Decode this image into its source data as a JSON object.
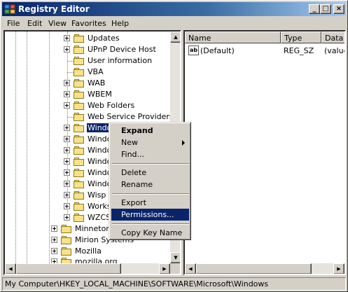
{
  "window": {
    "title": "Registry Editor",
    "controls": {
      "minimize": "_",
      "maximize": "□",
      "close": "×"
    }
  },
  "menu": [
    "File",
    "Edit",
    "View",
    "Favorites",
    "Help"
  ],
  "tree": {
    "microsoft_children": [
      {
        "label": "Updates",
        "expandable": true
      },
      {
        "label": "UPnP Device Host",
        "expandable": true
      },
      {
        "label": "User information",
        "expandable": false
      },
      {
        "label": "VBA",
        "expandable": false
      },
      {
        "label": "WAB",
        "expandable": true
      },
      {
        "label": "WBEM",
        "expandable": true
      },
      {
        "label": "Web Folders",
        "expandable": true
      },
      {
        "label": "Web Service Providers",
        "expandable": false
      },
      {
        "label": "Windows",
        "expandable": true,
        "selected": true
      },
      {
        "label": "Windo",
        "expandable": true
      },
      {
        "label": "Windo",
        "expandable": true
      },
      {
        "label": "Windo",
        "expandable": true
      },
      {
        "label": "Windo",
        "expandable": true
      },
      {
        "label": "Windo",
        "expandable": true
      },
      {
        "label": "Wisp",
        "expandable": true
      },
      {
        "label": "Works",
        "expandable": true
      },
      {
        "label": "WZCS",
        "expandable": true
      }
    ],
    "software_children": [
      {
        "label": "Minnetonk",
        "expandable": true
      },
      {
        "label": "Mirion Systems",
        "expandable": true
      },
      {
        "label": "Mozilla",
        "expandable": true
      },
      {
        "label": "mozilla.org",
        "expandable": true
      }
    ]
  },
  "list": {
    "columns": [
      "Name",
      "Type",
      "Data"
    ],
    "rows": [
      {
        "icon": "ab",
        "name": "(Default)",
        "type": "REG_SZ",
        "data": "(value"
      }
    ]
  },
  "context_menu": {
    "items": [
      {
        "label": "Expand",
        "bold": true
      },
      {
        "label": "New",
        "submenu": true
      },
      {
        "label": "Find..."
      },
      {
        "label": "Delete"
      },
      {
        "label": "Rename"
      },
      {
        "label": "Export"
      },
      {
        "label": "Permissions...",
        "highlighted": true
      },
      {
        "label": "Copy Key Name"
      }
    ]
  },
  "status": {
    "path": "My Computer\\HKEY_LOCAL_MACHINE\\SOFTWARE\\Microsoft\\Windows"
  },
  "colors": {
    "title_start": "#0a246a",
    "title_end": "#a6caf0",
    "selection": "#0a246a",
    "face": "#d4d0c8"
  }
}
